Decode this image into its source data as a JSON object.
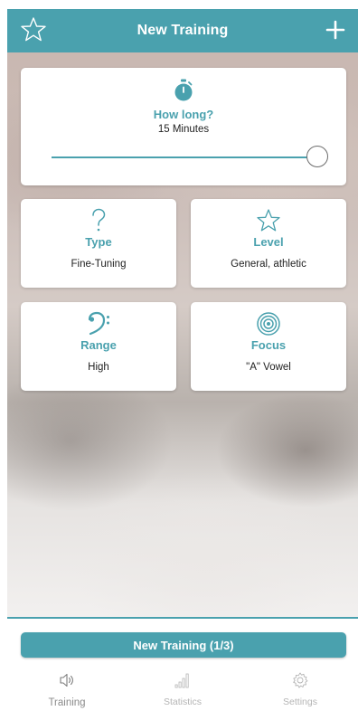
{
  "header": {
    "title": "New Training",
    "favorite_icon": "star-outline-icon",
    "add_icon": "plus-icon"
  },
  "duration": {
    "label": "How long?",
    "value": "15 Minutes",
    "icon": "stopwatch-icon",
    "slider_level": 1.0
  },
  "cards": {
    "type": {
      "label": "Type",
      "value": "Fine-Tuning",
      "icon": "question-mark-icon"
    },
    "level": {
      "label": "Level",
      "value": "General, athletic",
      "icon": "star-outline-icon"
    },
    "range": {
      "label": "Range",
      "value": "High",
      "icon": "bass-clef-icon"
    },
    "focus": {
      "label": "Focus",
      "value": "\"A\" Vowel",
      "icon": "target-icon"
    }
  },
  "primary_button": {
    "label": "New Training (1/3)"
  },
  "nav": {
    "items": [
      {
        "label": "Training",
        "icon": "speaker-icon",
        "active": true
      },
      {
        "label": "Statistics",
        "icon": "bar-chart-icon",
        "active": false
      },
      {
        "label": "Settings",
        "icon": "gear-icon",
        "active": false
      }
    ]
  },
  "colors": {
    "accent": "#4aa1ae",
    "text": "#222222",
    "nav_inactive": "#b5b5b5"
  }
}
